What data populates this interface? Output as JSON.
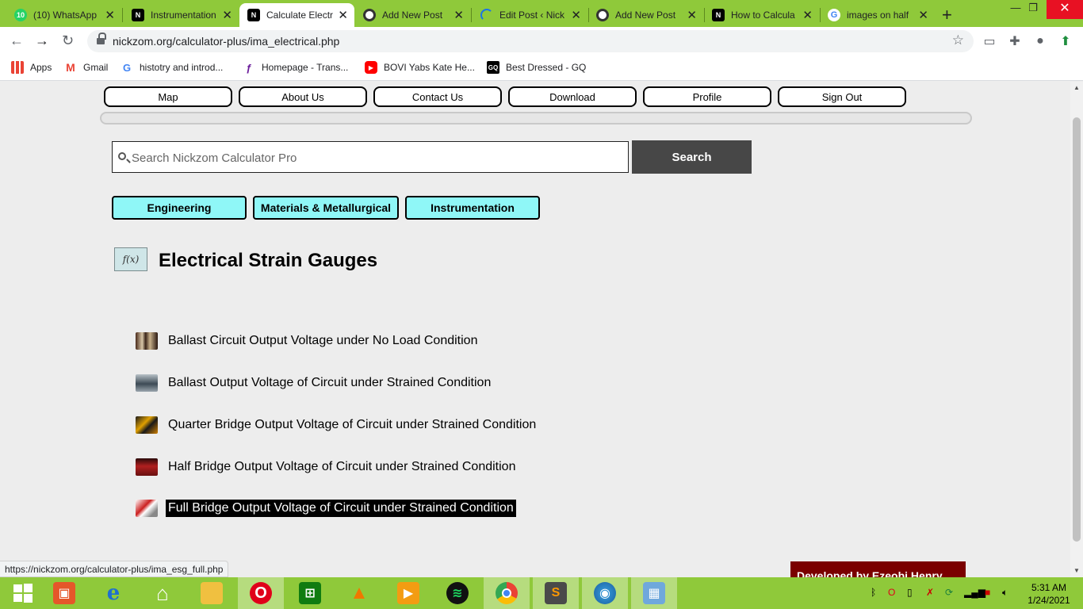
{
  "browser": {
    "tabs": [
      {
        "title": "(10) WhatsApp",
        "favicon": "whatsapp-icon",
        "color": "#25d366"
      },
      {
        "title": "Instrumentation",
        "favicon": "nickzom-icon",
        "color": "#000000"
      },
      {
        "title": "Calculate Electr",
        "favicon": "nickzom-icon",
        "color": "#000000",
        "active": true
      },
      {
        "title": "Add New Post",
        "favicon": "wordpress-icon",
        "color": "#333333"
      },
      {
        "title": "Edit Post ‹ Nick",
        "favicon": "loading-icon",
        "color": "#1a73e8"
      },
      {
        "title": "Add New Post",
        "favicon": "wordpress-icon",
        "color": "#333333"
      },
      {
        "title": "How to Calcula",
        "favicon": "nickzom-icon",
        "color": "#000000"
      },
      {
        "title": "images on half",
        "favicon": "google-icon",
        "color": "#4285f4"
      }
    ],
    "url": "nickzom.org/calculator-plus/ima_electrical.php",
    "bookmarks": [
      {
        "label": "Apps",
        "icon": "apps-grid-icon"
      },
      {
        "label": "Gmail",
        "icon": "gmail-icon"
      },
      {
        "label": "histotry and introd...",
        "icon": "google-icon"
      },
      {
        "label": "Homepage - Trans...",
        "icon": "bookmark-site-icon"
      },
      {
        "label": "BOVI Yabs Kate He...",
        "icon": "youtube-icon"
      },
      {
        "label": "Best Dressed - GQ",
        "icon": "gq-icon"
      }
    ],
    "status_url": "https://nickzom.org/calculator-plus/ima_esg_full.php"
  },
  "site": {
    "nav": [
      "Map",
      "About Us",
      "Contact Us",
      "Download",
      "Profile",
      "Sign Out"
    ],
    "search": {
      "placeholder": "Search Nickzom Calculator Pro",
      "button": "Search"
    },
    "categories": [
      "Engineering",
      "Materials & Metallurgical",
      "Instrumentation"
    ],
    "fx_label": "f(x)",
    "title": "Electrical Strain Gauges",
    "calculators": [
      "Ballast Circuit Output Voltage under No Load Condition",
      "Ballast Output Voltage of Circuit under Strained Condition",
      "Quarter Bridge Output Voltage of Circuit under Strained Condition",
      "Half Bridge Output Voltage of Circuit under Strained Condition",
      "Full Bridge Output Voltage of Circuit under Strained Condition"
    ],
    "footer_banner": "Developed by Ezeobi Henry"
  },
  "taskbar": {
    "clock_time": "5:31 AM",
    "clock_date": "1/24/2021"
  },
  "colors": {
    "accent": "#8fc93a",
    "category_button": "#8ff7f7",
    "search_button": "#474747",
    "banner": "#7a0000"
  }
}
